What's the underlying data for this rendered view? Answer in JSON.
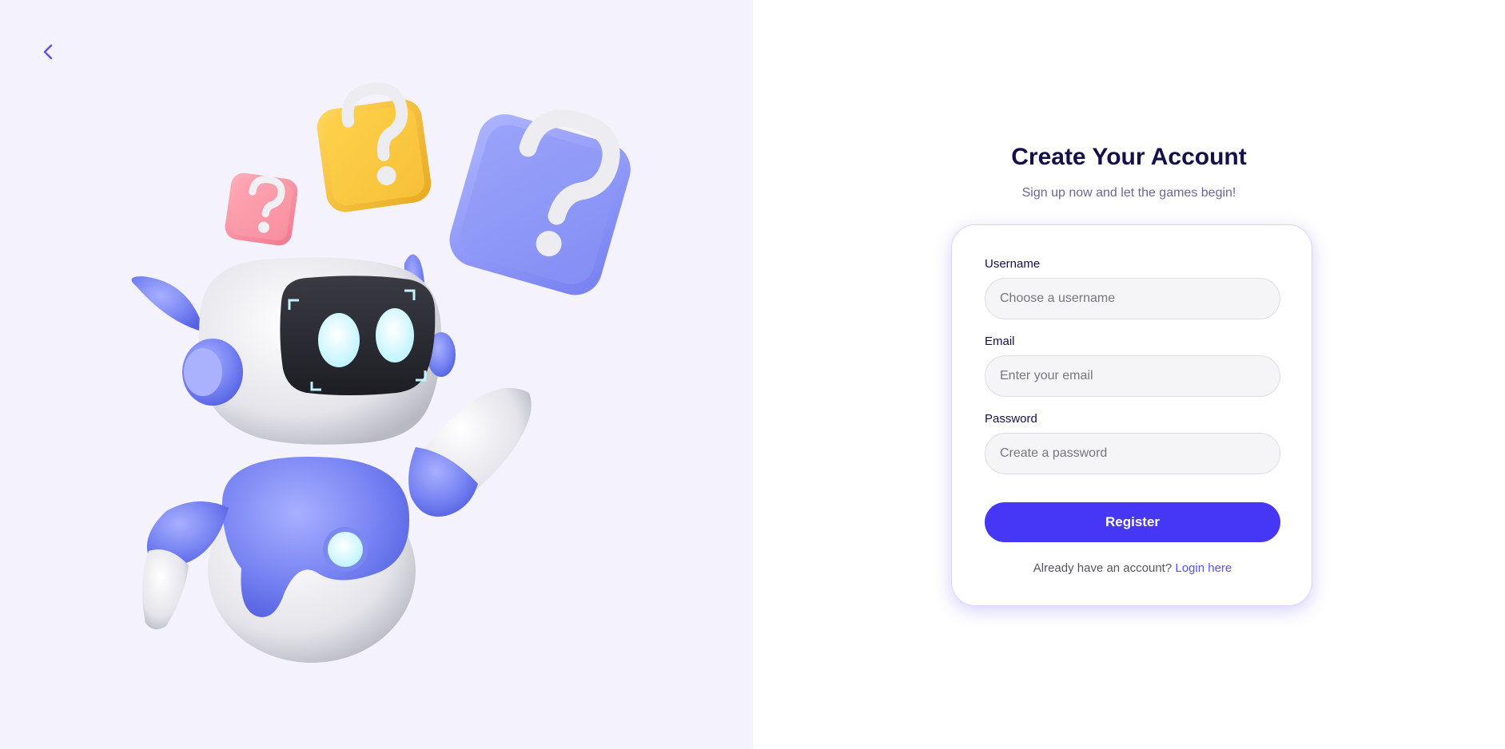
{
  "nav": {
    "back_icon": "chevron-left-icon"
  },
  "illustration": {
    "subject": "robot-with-question-marks",
    "accent": "#7b86f0"
  },
  "header": {
    "title": "Create Your Account",
    "subtitle": "Sign up now and let the games begin!"
  },
  "form": {
    "username": {
      "label": "Username",
      "placeholder": "Choose a username",
      "value": ""
    },
    "email": {
      "label": "Email",
      "placeholder": "Enter your email",
      "value": ""
    },
    "password": {
      "label": "Password",
      "placeholder": "Create a password",
      "value": ""
    },
    "submit_label": "Register"
  },
  "footer": {
    "prompt": "Already have an account?",
    "login_link": "Login here"
  },
  "colors": {
    "primary": "#4637f7",
    "link": "#5a4ff5",
    "heading": "#14104a",
    "left_background": "#f4f3fd"
  }
}
